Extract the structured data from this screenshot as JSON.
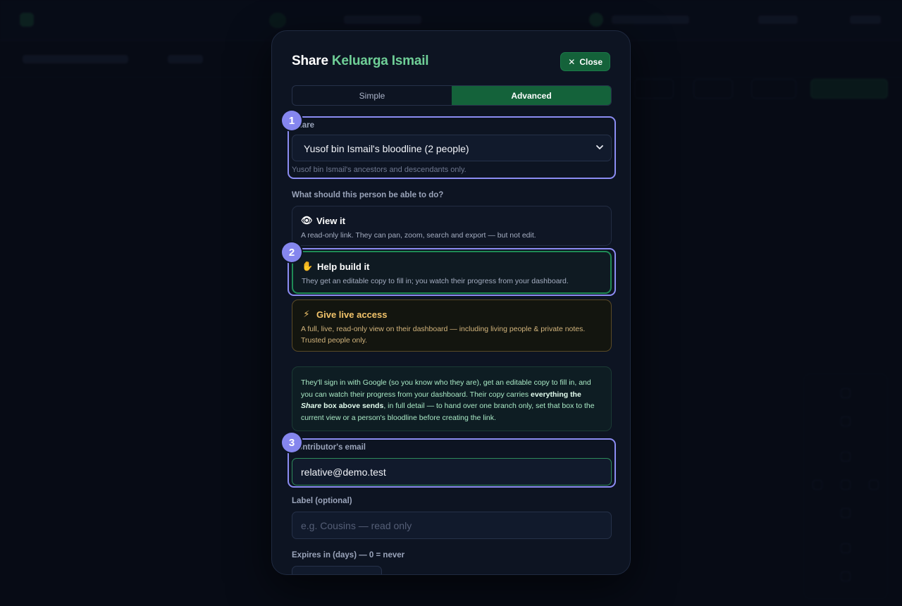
{
  "modal": {
    "title_prefix": "Share",
    "title_accent": "Keluarga Ismail",
    "close_label": "Close",
    "tabs": [
      {
        "label": "Simple",
        "active": false
      },
      {
        "label": "Advanced",
        "active": true
      }
    ]
  },
  "share": {
    "label": "Share",
    "selected": "Yusof bin Ismail's bloodline (2 people)",
    "hint": "Yusof bin Ismail's ancestors and descendants only."
  },
  "permissions": {
    "question": "What should this person be able to do?",
    "options": [
      {
        "icon": "eye-icon",
        "glyph": "👁",
        "title": "View it",
        "desc": "A read-only link. They can pan, zoom, search and export — but not edit."
      },
      {
        "icon": "hand-icon",
        "glyph": "✋",
        "title": "Help build it",
        "desc": "They get an editable copy to fill in; you watch their progress from your dashboard."
      },
      {
        "icon": "lightning-icon",
        "glyph": "⚡",
        "title": "Give live access",
        "desc": "A full, live, read-only view on their dashboard — including living people & private notes. Trusted people only."
      }
    ]
  },
  "info": {
    "part1": "They'll sign in with Google (so you know who they are), get an editable copy to fill in, and you can watch their progress from your dashboard. Their copy carries ",
    "bold1": "everything the ",
    "bold_italic": "Share",
    "bold2": " box above sends",
    "part2": ", in full detail — to hand over one branch only, set that box to the current view or a person's bloodline before creating the link."
  },
  "email": {
    "label": "Contributor's email",
    "value": "relative@demo.test"
  },
  "label_field": {
    "label": "Label (optional)",
    "placeholder": "e.g. Cousins — read only"
  },
  "expires": {
    "label": "Expires in (days) — 0 = never"
  },
  "tour": {
    "steps": [
      "1",
      "2",
      "3"
    ],
    "accent": "#8b8cf2"
  }
}
